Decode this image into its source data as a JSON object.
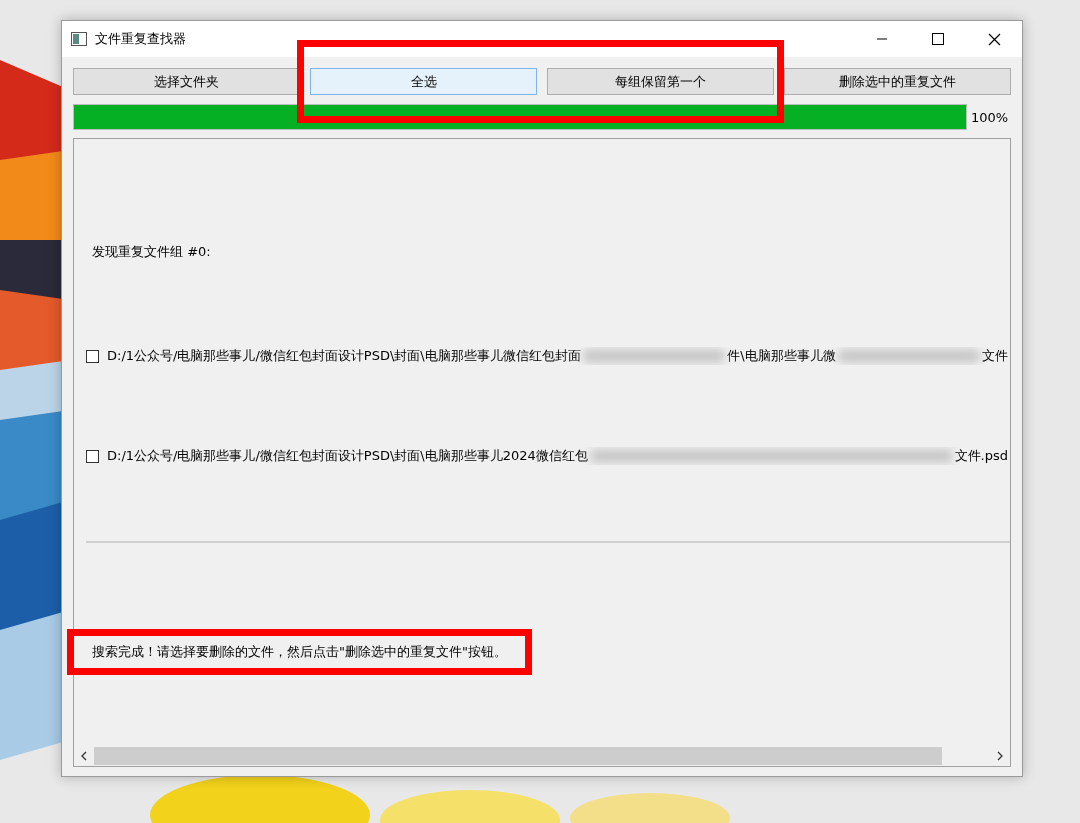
{
  "window": {
    "title": "文件重复查找器"
  },
  "buttons": [
    {
      "label": "选择文件夹",
      "focused": false,
      "highlighted": false
    },
    {
      "label": "全选",
      "focused": true,
      "highlighted": true
    },
    {
      "label": "每组保留第一个",
      "focused": false,
      "highlighted": true
    },
    {
      "label": "删除选中的重复文件",
      "focused": false,
      "highlighted": false
    }
  ],
  "progress": {
    "level": 1,
    "reading": "100%"
  },
  "results": {
    "group_label": "发现重复文件组 #0:",
    "files": [
      {
        "checked": false,
        "segments": [
          {
            "kind": "text",
            "text": "D:/1公众号/电脑那些事儿/微信红包封面设计PSD\\封面\\电脑那些事儿微信红包封面"
          },
          {
            "kind": "blurred"
          },
          {
            "kind": "text",
            "text": "件\\电脑那些事儿微"
          },
          {
            "kind": "blurred"
          },
          {
            "kind": "text",
            "text": "文件"
          }
        ]
      },
      {
        "checked": false,
        "segments": [
          {
            "kind": "text",
            "text": "D:/1公众号/电脑那些事儿/微信红包封面设计PSD\\封面\\电脑那些事儿2024微信红包"
          },
          {
            "kind": "blurred"
          },
          {
            "kind": "text",
            "text": "文件.psd"
          }
        ]
      }
    ],
    "status": {
      "text": "搜索完成！请选择要删除的文件，然后点击\"删除选中的重复文件\"按钮。",
      "highlighted": true
    }
  }
}
